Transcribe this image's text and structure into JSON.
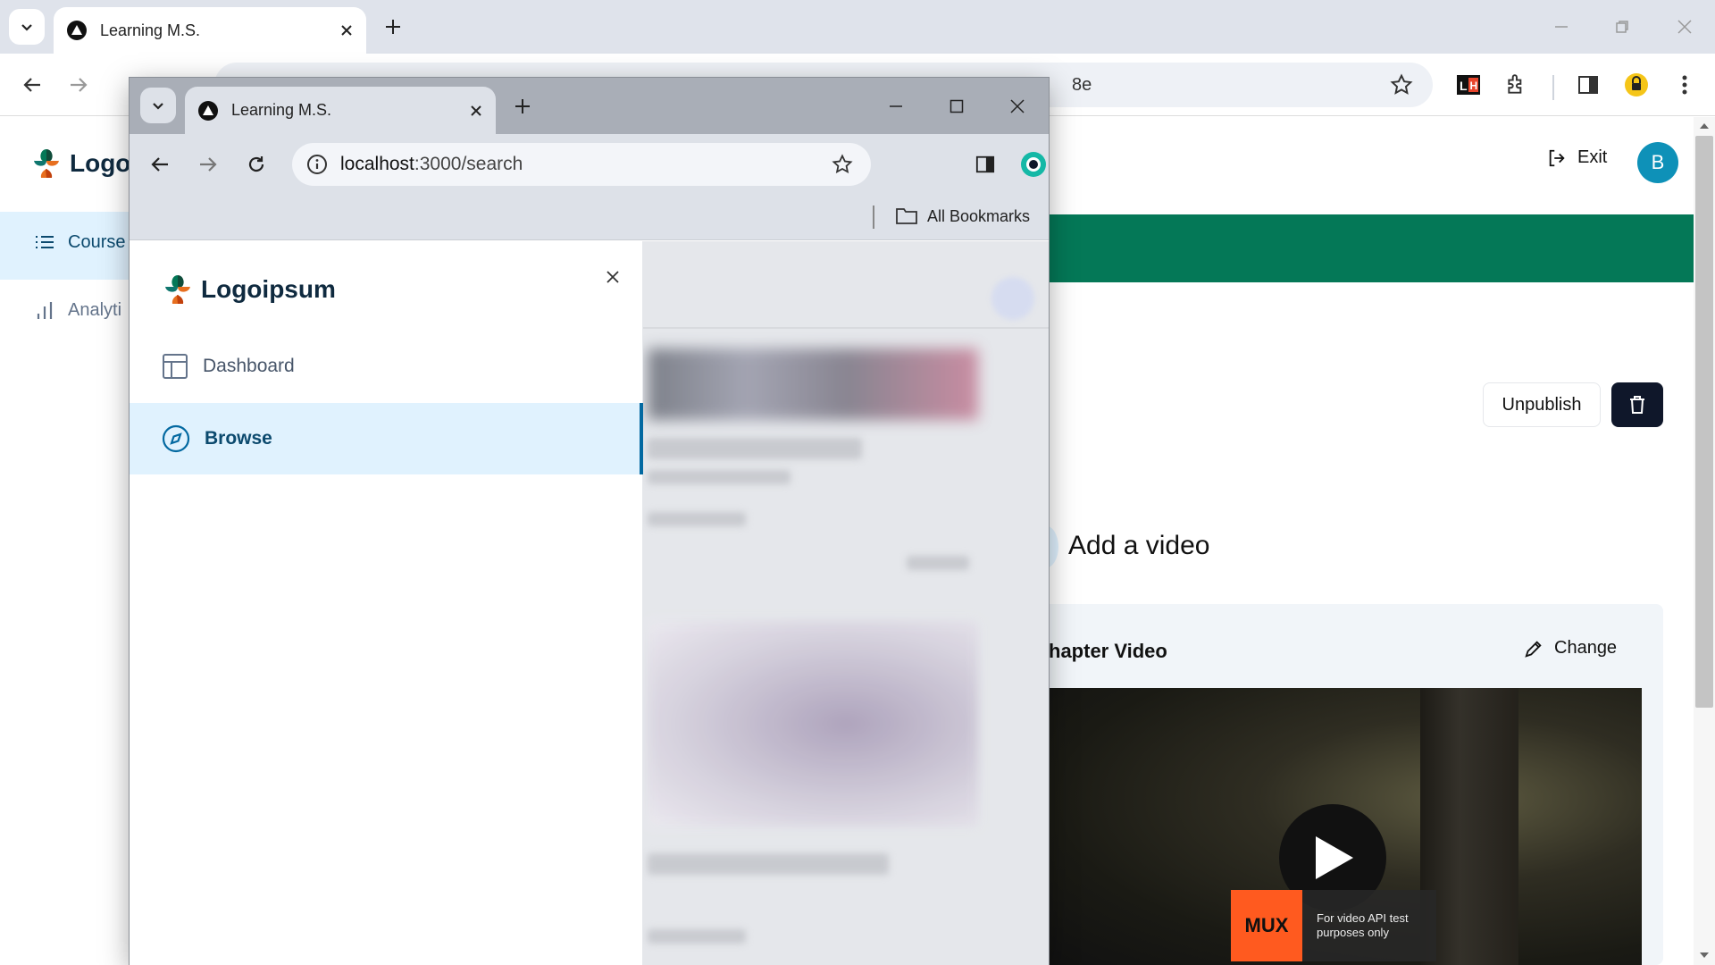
{
  "outer_browser": {
    "tab_title": "Learning M.S.",
    "address_suffix": "8e"
  },
  "outer_app": {
    "logo_text": "Logoi",
    "sidebar": [
      {
        "label": "Course",
        "icon": "list-icon",
        "active": true
      },
      {
        "label": "Analyti",
        "icon": "bar-chart-icon",
        "active": false
      }
    ],
    "header": {
      "exit_label": "Exit",
      "avatar_initial": "B"
    },
    "actions": {
      "unpublish_label": "Unpublish"
    },
    "video_section": {
      "title": "Add a video",
      "card_title": "hapter Video",
      "change_label": "Change",
      "mux_label": "MUX",
      "mux_note": "For video API test purposes only"
    },
    "colors": {
      "accent_green": "#047857",
      "avatar": "#0e91b8",
      "dark_button": "#0f172a"
    }
  },
  "inner_browser": {
    "tab_title": "Learning M.S.",
    "url_host": "localhost",
    "url_rest": ":3000/search",
    "bookmarks_label": "All Bookmarks"
  },
  "inner_app": {
    "logo_text": "Logoipsum",
    "nav": [
      {
        "label": "Dashboard",
        "icon": "layout-icon",
        "active": false
      },
      {
        "label": "Browse",
        "icon": "compass-icon",
        "active": true
      }
    ]
  }
}
